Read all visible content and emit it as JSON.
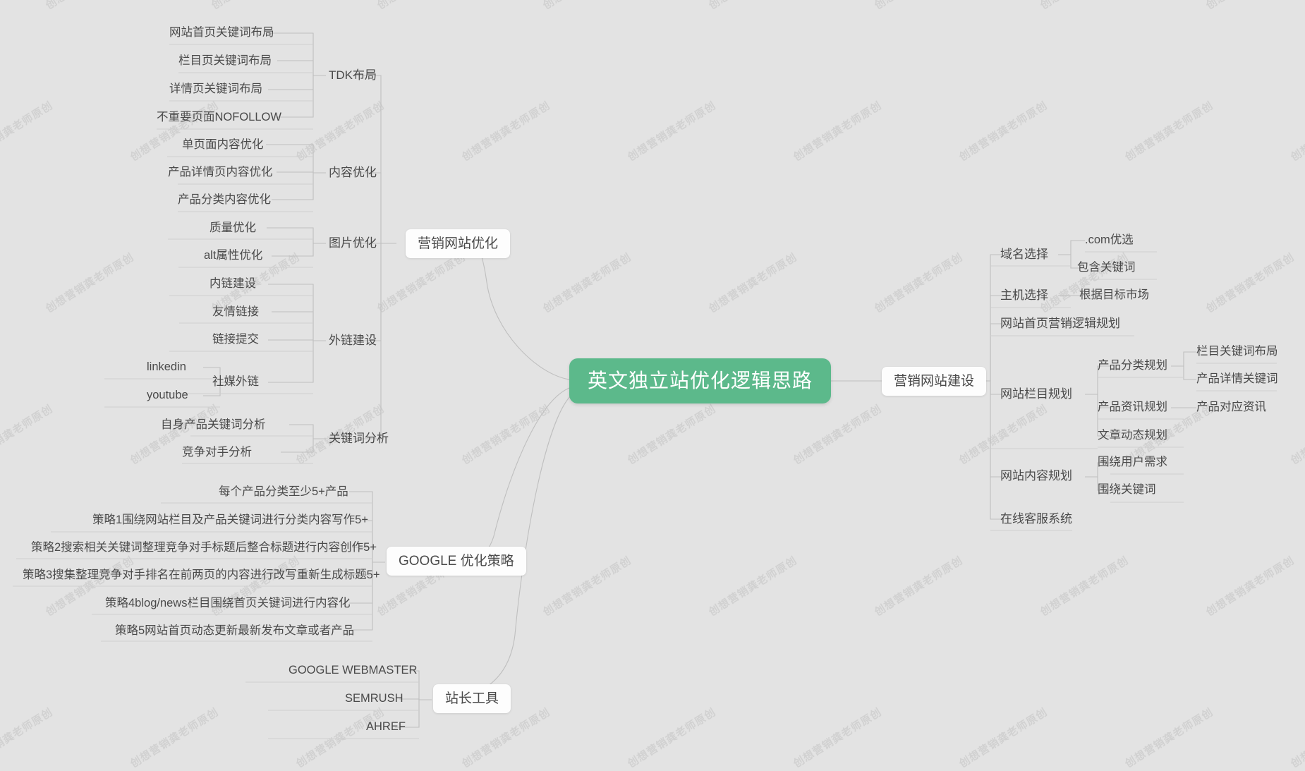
{
  "theme": {
    "background": "#e3e3e3",
    "root_fill": "#5cb98b",
    "root_text": "#ffffff",
    "node_text": "#4a4a4a",
    "branch_fill": "#fdfdfd",
    "link_color": "#bdbdbd"
  },
  "root": {
    "label": "英文独立站优化逻辑思路"
  },
  "watermark": {
    "text": "创想营销龚老师原创"
  },
  "branches": [
    {
      "id": "marketing-site-optimization",
      "label": "营销网站优化",
      "groups": [
        {
          "id": "tdk-layout",
          "label": "TDK布局",
          "items": [
            "网站首页关键词布局",
            "栏目页关键词布局",
            "详情页关键词布局",
            "不重要页面NOFOLLOW"
          ]
        },
        {
          "id": "content-optimization",
          "label": "内容优化",
          "items": [
            "单页面内容优化",
            "产品详情页内容优化",
            "产品分类内容优化"
          ]
        },
        {
          "id": "image-optimization",
          "label": "图片优化",
          "items": [
            "质量优化",
            "alt属性优化"
          ]
        },
        {
          "id": "external-link-building",
          "label": "外链建设",
          "items": [
            "内链建设",
            "友情链接",
            "链接提交",
            "社媒外链"
          ],
          "subitems": [
            "linkedin",
            "youtube"
          ]
        },
        {
          "id": "keyword-analysis",
          "label": "关键词分析",
          "items": [
            "自身产品关键词分析",
            "竞争对手分析"
          ]
        }
      ]
    },
    {
      "id": "marketing-site-construction",
      "label": "营销网站建设",
      "groups": [
        {
          "id": "domain-selection",
          "label": "域名选择",
          "items": [
            ".com优选",
            "包含关键词"
          ]
        },
        {
          "id": "host-selection",
          "label": "主机选择",
          "items": [
            "根据目标市场"
          ]
        },
        {
          "id": "homepage-marketing-logic",
          "label": "网站首页营销逻辑规划",
          "items": []
        },
        {
          "id": "site-column-planning",
          "label": "网站栏目规划",
          "items": [
            "产品分类规划",
            "产品资讯规划",
            "文章动态规划"
          ],
          "subitems": [
            "栏目关键词布局",
            "产品详情关键词",
            "产品对应资讯"
          ]
        },
        {
          "id": "site-content-planning",
          "label": "网站内容规划",
          "items": [
            "围绕用户需求",
            "围绕关键词"
          ]
        },
        {
          "id": "online-customer-service",
          "label": "在线客服系统",
          "items": []
        }
      ]
    },
    {
      "id": "google-optimization-strategy",
      "label": "GOOGLE 优化策略",
      "items": [
        "每个产品分类至少5+产品",
        "策略1围绕网站栏目及产品关键词进行分类内容写作5+",
        "策略2搜索相关关键词整理竞争对手标题后整合标题进行内容创作5+",
        "策略3搜集整理竞争对手排名在前两页的内容进行改写重新生成标题5+",
        "策略4blog/news栏目围绕首页关键词进行内容化",
        "策略5网站首页动态更新最新发布文章或者产品"
      ]
    },
    {
      "id": "webmaster-tools",
      "label": "站长工具",
      "items": [
        "GOOGLE WEBMASTER",
        "SEMRUSH",
        "AHREF"
      ]
    }
  ],
  "nodes": {
    "left": {
      "tdk": {
        "l1": "网站首页关键词布局",
        "l2": "栏目页关键词布局",
        "l3": "详情页关键词布局",
        "l4": "不重要页面NOFOLLOW",
        "label": "TDK布局"
      },
      "content": {
        "l1": "单页面内容优化",
        "l2": "产品详情页内容优化",
        "l3": "产品分类内容优化",
        "label": "内容优化"
      },
      "image": {
        "l1": "质量优化",
        "l2": "alt属性优化",
        "label": "图片优化"
      },
      "links": {
        "l1": "内链建设",
        "l2": "友情链接",
        "l3": "链接提交",
        "l4": "社媒外链",
        "s1": "linkedin",
        "s2": "youtube",
        "label": "外链建设"
      },
      "keywords": {
        "l1": "自身产品关键词分析",
        "l2": "竞争对手分析",
        "label": "关键词分析"
      },
      "branch": "营销网站优化"
    },
    "google": {
      "l1": "每个产品分类至少5+产品",
      "l2": "策略1围绕网站栏目及产品关键词进行分类内容写作5+",
      "l3": "策略2搜索相关关键词整理竞争对手标题后整合标题进行内容创作5+",
      "l4": "策略3搜集整理竞争对手排名在前两页的内容进行改写重新生成标题5+",
      "l5": "策略4blog/news栏目围绕首页关键词进行内容化",
      "l6": "策略5网站首页动态更新最新发布文章或者产品",
      "branch": "GOOGLE 优化策略"
    },
    "webmaster": {
      "l1": "GOOGLE WEBMASTER",
      "l2": "SEMRUSH",
      "l3": "AHREF",
      "branch": "站长工具"
    },
    "right": {
      "branch": "营销网站建设",
      "domain": "域名选择",
      "domain_s1": ".com优选",
      "domain_s2": "包含关键词",
      "host": "主机选择",
      "host_s1": "根据目标市场",
      "homepage": "网站首页营销逻辑规划",
      "column": "网站栏目规划",
      "column_s1": "产品分类规划",
      "column_s1_1": "栏目关键词布局",
      "column_s1_2": "产品详情关键词",
      "column_s2": "产品资讯规划",
      "column_s2_1": "产品对应资讯",
      "column_s3": "文章动态规划",
      "content": "网站内容规划",
      "content_s1": "围绕用户需求",
      "content_s2": "围绕关键词",
      "service": "在线客服系统"
    }
  }
}
